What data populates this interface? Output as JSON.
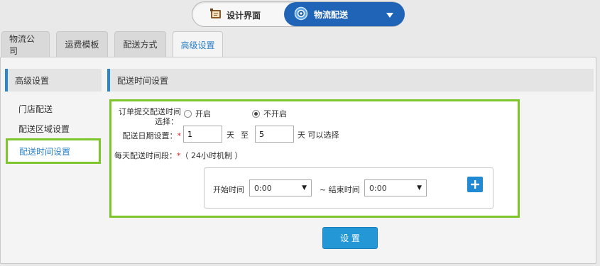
{
  "mode_switch": {
    "design_label": "设计界面",
    "logistics_label": "物流配送",
    "design_icon": "design-board-icon",
    "logistics_icon": "gear-icon"
  },
  "tabs": [
    {
      "label": "物流公司",
      "active": false
    },
    {
      "label": "运费模板",
      "active": false
    },
    {
      "label": "配送方式",
      "active": false
    },
    {
      "label": "高级设置",
      "active": true
    }
  ],
  "sidebar": {
    "header": "高级设置",
    "items": [
      {
        "label": "门店配送",
        "active": false
      },
      {
        "label": "配送区域设置",
        "active": false
      },
      {
        "label": "配送时间设置",
        "active": true
      }
    ]
  },
  "content": {
    "header": "配送时间设置",
    "order_submit": {
      "label_line1": "订单提交配送时间",
      "label_line2": "选择：",
      "options": [
        {
          "label": "开启",
          "checked": false
        },
        {
          "label": "不开启",
          "checked": true
        }
      ]
    },
    "delivery_date": {
      "label": "配送日期设置：",
      "required_mark": "*",
      "from_value": "1",
      "day_unit": "天",
      "to_word": "至",
      "to_value": "5",
      "suffix": "天 可以选择"
    },
    "daily_period": {
      "label": "每天配送时间段：",
      "required_mark": "*",
      "note": "（ 24小时机制 ）",
      "start_label": "开始时间",
      "start_value": "0:00",
      "end_label": "~ 结束时间",
      "end_value": "0:00"
    },
    "save_label": "设 置"
  },
  "colors": {
    "accent_blue": "#2064b8",
    "button_blue": "#2497d7",
    "highlight_green": "#7cc52a",
    "required_red": "#e02020"
  }
}
